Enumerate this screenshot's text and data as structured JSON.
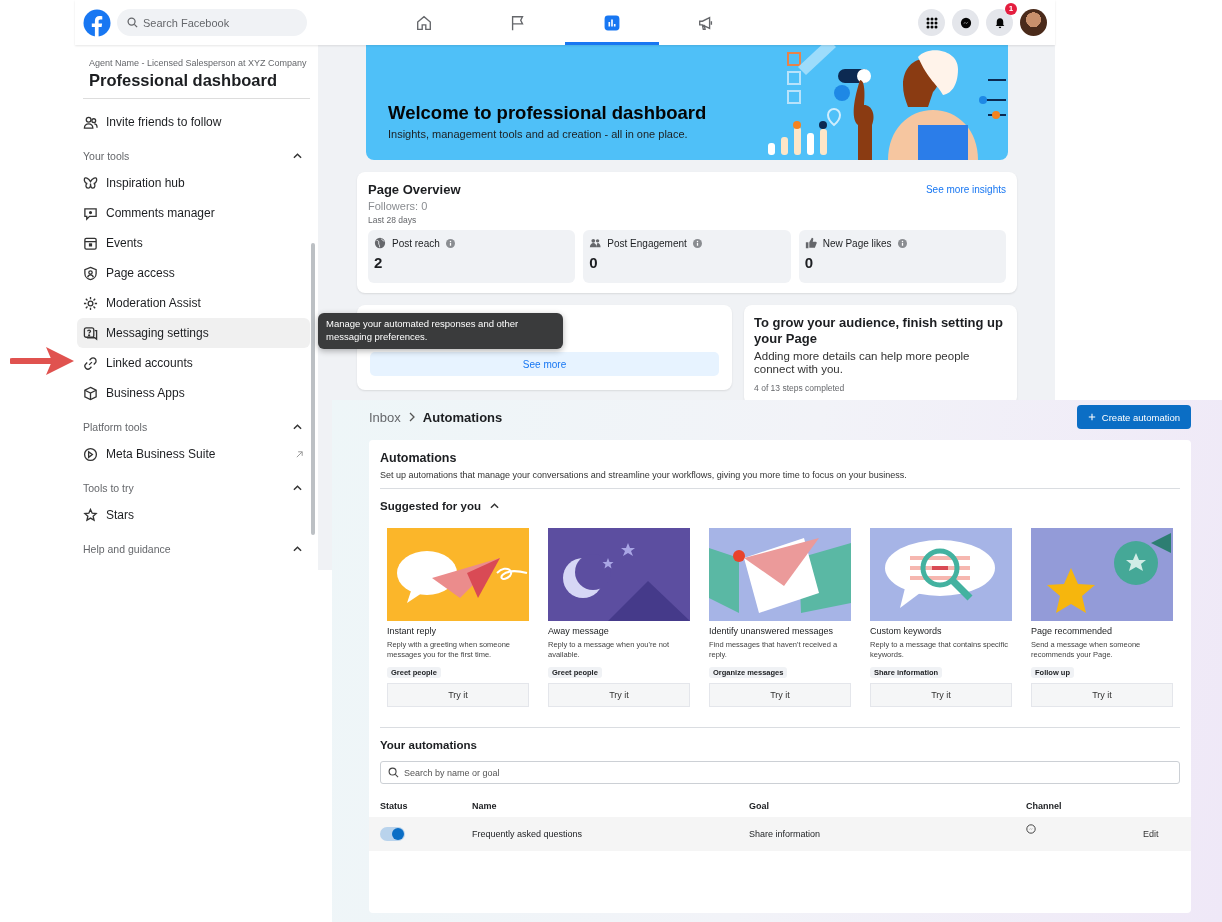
{
  "top_bar": {
    "search": {
      "placeholder": "Search Facebook"
    },
    "nav_tabs": [
      {
        "selected": false
      },
      {
        "selected": false
      },
      {
        "selected": true
      },
      {
        "selected": false
      }
    ],
    "notification_badge": "1"
  },
  "sidebar": {
    "subtitle": "Agent Name - Licensed Salesperson at XYZ Company",
    "title": "Professional dashboard",
    "top_items": [
      {
        "label": "Invite friends to follow",
        "selected": false,
        "external": false
      }
    ],
    "sections": [
      {
        "title": "Your tools",
        "expanded": true,
        "items": [
          {
            "label": "Inspiration hub",
            "selected": false,
            "external": false
          },
          {
            "label": "Comments manager",
            "selected": false,
            "external": false
          },
          {
            "label": "Events",
            "selected": false,
            "external": false
          },
          {
            "label": "Page access",
            "selected": false,
            "external": false
          },
          {
            "label": "Moderation Assist",
            "selected": false,
            "external": false
          },
          {
            "label": "Messaging settings",
            "selected": true,
            "external": false
          },
          {
            "label": "Linked accounts",
            "selected": false,
            "external": false
          },
          {
            "label": "Business Apps",
            "selected": false,
            "external": false
          }
        ]
      },
      {
        "title": "Platform tools",
        "expanded": true,
        "items": [
          {
            "label": "Meta Business Suite",
            "selected": false,
            "external": true
          }
        ]
      },
      {
        "title": "Tools to try",
        "expanded": true,
        "items": [
          {
            "label": "Stars",
            "selected": false,
            "external": false
          }
        ]
      },
      {
        "title": "Help and guidance",
        "expanded": true
      }
    ]
  },
  "banner": {
    "title": "Welcome to professional dashboard",
    "subtitle": "Insights, management tools and ad creation - all in one place."
  },
  "page_overview": {
    "title": "Page Overview",
    "followers": "Followers: 0",
    "period": "Last 28 days",
    "link": "See more insights",
    "metrics": [
      {
        "label": "Post reach",
        "value": "2"
      },
      {
        "label": "Post Engagement",
        "value": "0"
      },
      {
        "label": "New Page likes",
        "value": "0"
      }
    ]
  },
  "messaging_card": {
    "button": "See more"
  },
  "tooltip": {
    "text": "Manage your automated responses and other messaging preferences."
  },
  "setup_card": {
    "title": "To grow your audience, finish setting up your Page",
    "text": "Adding more details can help more people connect with you.",
    "progress": "4 of 13 steps completed"
  },
  "automations": {
    "breadcrumb": [
      "Inbox",
      "Automations"
    ],
    "create_button": "Create automation",
    "title": "Automations",
    "description": "Set up automations that manage your conversations and streamline your workflows, giving you more time to focus on your business.",
    "suggested": {
      "title": "Suggested for you",
      "expanded": true,
      "items": [
        {
          "title": "Instant reply",
          "description": "Reply with a greeting when someone messages you for the first time.",
          "tag": "Greet people",
          "button": "Try it"
        },
        {
          "title": "Away message",
          "description": "Reply to a message when you're not available.",
          "tag": "Greet people",
          "button": "Try it"
        },
        {
          "title": "Identify unanswered messages",
          "description": "Find messages that haven't received a reply.",
          "tag": "Organize messages",
          "button": "Try it"
        },
        {
          "title": "Custom keywords",
          "description": "Reply to a message that contains specific keywords.",
          "tag": "Share information",
          "button": "Try it"
        },
        {
          "title": "Page recommended",
          "description": "Send a message when someone recommends your Page.",
          "tag": "Follow up",
          "button": "Try it"
        }
      ]
    },
    "your_automations": {
      "title": "Your automations",
      "search": {
        "placeholder": "Search by name or goal"
      },
      "columns": [
        "Status",
        "Name",
        "Goal",
        "Channel"
      ],
      "rows": [
        {
          "on": true,
          "name": "Frequently asked questions",
          "goal": "Share information",
          "action": "Edit"
        }
      ]
    }
  }
}
